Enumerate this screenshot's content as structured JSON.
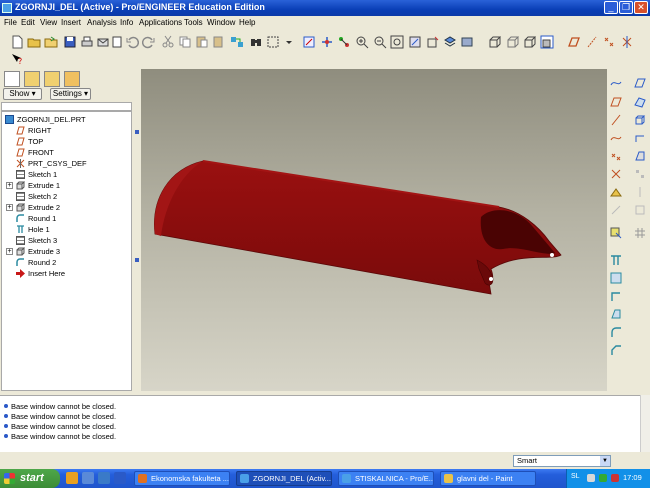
{
  "window": {
    "title": "ZGORNJI_DEL (Active) - Pro/ENGINEER Education Edition"
  },
  "menu": [
    "File",
    "Edit",
    "View",
    "Insert",
    "Analysis",
    "Info",
    "Applications",
    "Tools",
    "Window",
    "Help"
  ],
  "navigator": {
    "show_label": "Show ▾",
    "settings_label": "Settings ▾",
    "root": "ZGORNJI_DEL.PRT",
    "items": [
      {
        "label": "RIGHT",
        "icon": "datum-plane-icon",
        "expandable": false
      },
      {
        "label": "TOP",
        "icon": "datum-plane-icon",
        "expandable": false
      },
      {
        "label": "FRONT",
        "icon": "datum-plane-icon",
        "expandable": false
      },
      {
        "label": "PRT_CSYS_DEF",
        "icon": "csys-icon",
        "expandable": false
      },
      {
        "label": "Sketch 1",
        "icon": "sketch-icon",
        "expandable": false
      },
      {
        "label": "Extrude 1",
        "icon": "extrude-icon",
        "expandable": true
      },
      {
        "label": "Sketch 2",
        "icon": "sketch-icon",
        "expandable": false
      },
      {
        "label": "Extrude 2",
        "icon": "extrude-icon",
        "expandable": true
      },
      {
        "label": "Round 1",
        "icon": "round-icon",
        "expandable": false
      },
      {
        "label": "Hole 1",
        "icon": "hole-icon",
        "expandable": false
      },
      {
        "label": "Sketch 3",
        "icon": "sketch-icon",
        "expandable": false
      },
      {
        "label": "Extrude 3",
        "icon": "extrude-icon",
        "expandable": true
      },
      {
        "label": "Round 2",
        "icon": "round-icon",
        "expandable": false
      },
      {
        "label": "Insert Here",
        "icon": "insert-arrow-icon",
        "expandable": false
      }
    ]
  },
  "messages": [
    "Base window cannot be closed.",
    "Base window cannot be closed.",
    "Base window cannot be closed.",
    "Base window cannot be closed."
  ],
  "filter": {
    "value": "Smart"
  },
  "taskbar": {
    "start_label": "start",
    "tasks": [
      {
        "label": "Ekonomska fakulteta ...",
        "active": false
      },
      {
        "label": "ZGORNJI_DEL (Activ...",
        "active": true
      },
      {
        "label": "STISKALNICA - Pro/E...",
        "active": false
      },
      {
        "label": "glavni del - Paint",
        "active": false
      }
    ],
    "language": "SL",
    "clock": "17:09"
  },
  "colors": {
    "part": "#8a0d0d",
    "titlebar": "#0a3fb6",
    "datum": "#c05020"
  }
}
